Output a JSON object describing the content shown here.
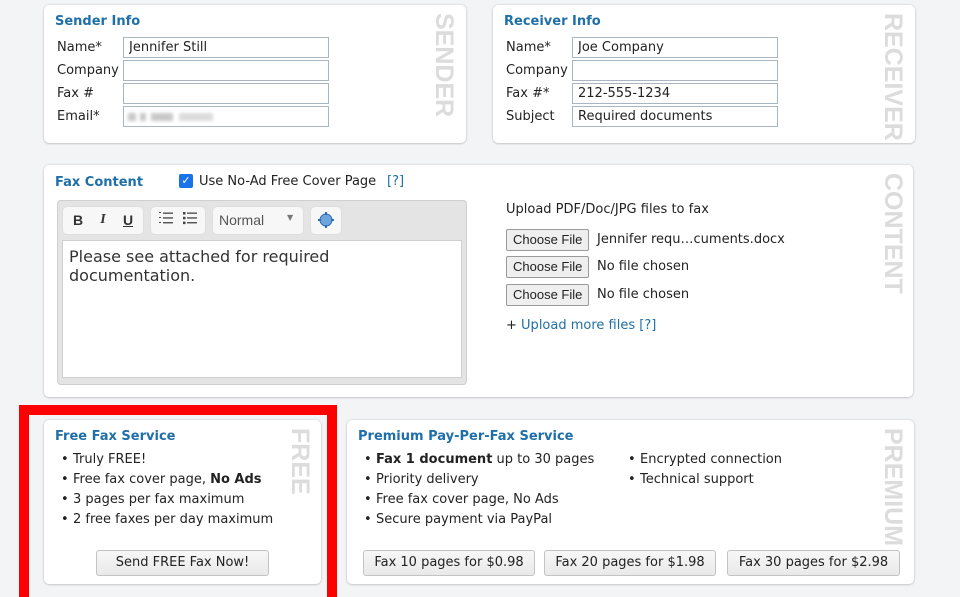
{
  "sender": {
    "title": "Sender Info",
    "watermark": "SENDER",
    "fields": [
      {
        "label": "Name*",
        "value": "Jennifer Still",
        "placeholder": ""
      },
      {
        "label": "Company",
        "value": "",
        "placeholder": ""
      },
      {
        "label": "Fax #",
        "value": "",
        "placeholder": ""
      },
      {
        "label": "Email*",
        "value": "",
        "placeholder": "",
        "blurred": true
      }
    ]
  },
  "receiver": {
    "title": "Receiver Info",
    "watermark": "RECEIVER",
    "fields": [
      {
        "label": "Name*",
        "value": "Joe Company"
      },
      {
        "label": "Company",
        "value": ""
      },
      {
        "label": "Fax #*",
        "value": "212-555-1234"
      },
      {
        "label": "Subject",
        "value": "Required documents"
      }
    ]
  },
  "content": {
    "title": "Fax Content",
    "watermark": "CONTENT",
    "cover_page_checkbox": {
      "label": "Use No-Ad Free Cover Page",
      "checked": true,
      "help": "[?]"
    },
    "editor": {
      "toolbar": {
        "bold": "B",
        "italic": "I",
        "underline": "U",
        "format_select": "Normal"
      },
      "body_text": "Please see attached for required documentation."
    },
    "upload": {
      "label": "Upload PDF/Doc/JPG files to fax",
      "files": [
        {
          "button": "Choose File",
          "status": "Jennifer requ…cuments.docx"
        },
        {
          "button": "Choose File",
          "status": "No file chosen"
        },
        {
          "button": "Choose File",
          "status": "No file chosen"
        }
      ],
      "more_prefix": "+",
      "more_link": "Upload more files",
      "more_help": "[?]"
    }
  },
  "free_service": {
    "title": "Free Fax Service",
    "watermark": "FREE",
    "bullets": [
      {
        "text": "Truly FREE!",
        "bold": ""
      },
      {
        "text": "Free fax cover page, ",
        "bold": "No Ads"
      },
      {
        "text": "3 pages per fax maximum",
        "bold": ""
      },
      {
        "text": "2 free faxes per day maximum",
        "bold": ""
      }
    ],
    "button": "Send FREE Fax Now!",
    "highlight_color": "#ff0000"
  },
  "premium_service": {
    "title": "Premium Pay-Per-Fax Service",
    "watermark": "PREMIUM",
    "bullets_left": [
      {
        "bold": "Fax 1 document",
        "text": " up to 30 pages"
      },
      {
        "bold": "",
        "text": "Priority delivery"
      },
      {
        "bold": "",
        "text": "Free fax cover page, No Ads"
      },
      {
        "bold": "",
        "text": "Secure payment via PayPal"
      }
    ],
    "bullets_right": [
      {
        "text": "Encrypted connection"
      },
      {
        "text": "Technical support"
      }
    ],
    "buttons": [
      "Fax 10 pages for $0.98",
      "Fax 20 pages for $1.98",
      "Fax 30 pages for $2.98"
    ]
  },
  "colors": {
    "accent": "#1f6fa8",
    "background": "#f3f4f6",
    "highlight": "#ff0000"
  }
}
